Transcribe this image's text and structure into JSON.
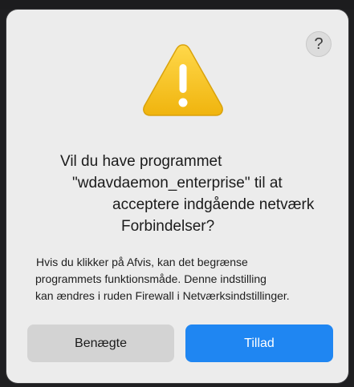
{
  "dialog": {
    "help_label": "?",
    "title_lines": [
      "Vil du have programmet",
      "\"wdavdaemon_enterprise\" til at",
      "acceptere indgående netværk",
      "Forbindelser?"
    ],
    "body_lines": [
      "Hvis du klikker på Afvis, kan det begrænse",
      "programmets funktionsmåde. Denne indstilling",
      "kan ændres i ruden Firewall i Netværksindstillinger."
    ],
    "buttons": {
      "deny_label": "Benægte",
      "allow_label": "Tillad"
    },
    "icon": "warning-triangle-icon",
    "colors": {
      "warning_yellow": "#f5c21a",
      "allow_blue": "#1f86f2",
      "deny_gray": "#d3d3d3",
      "dialog_bg": "#ececec"
    }
  }
}
